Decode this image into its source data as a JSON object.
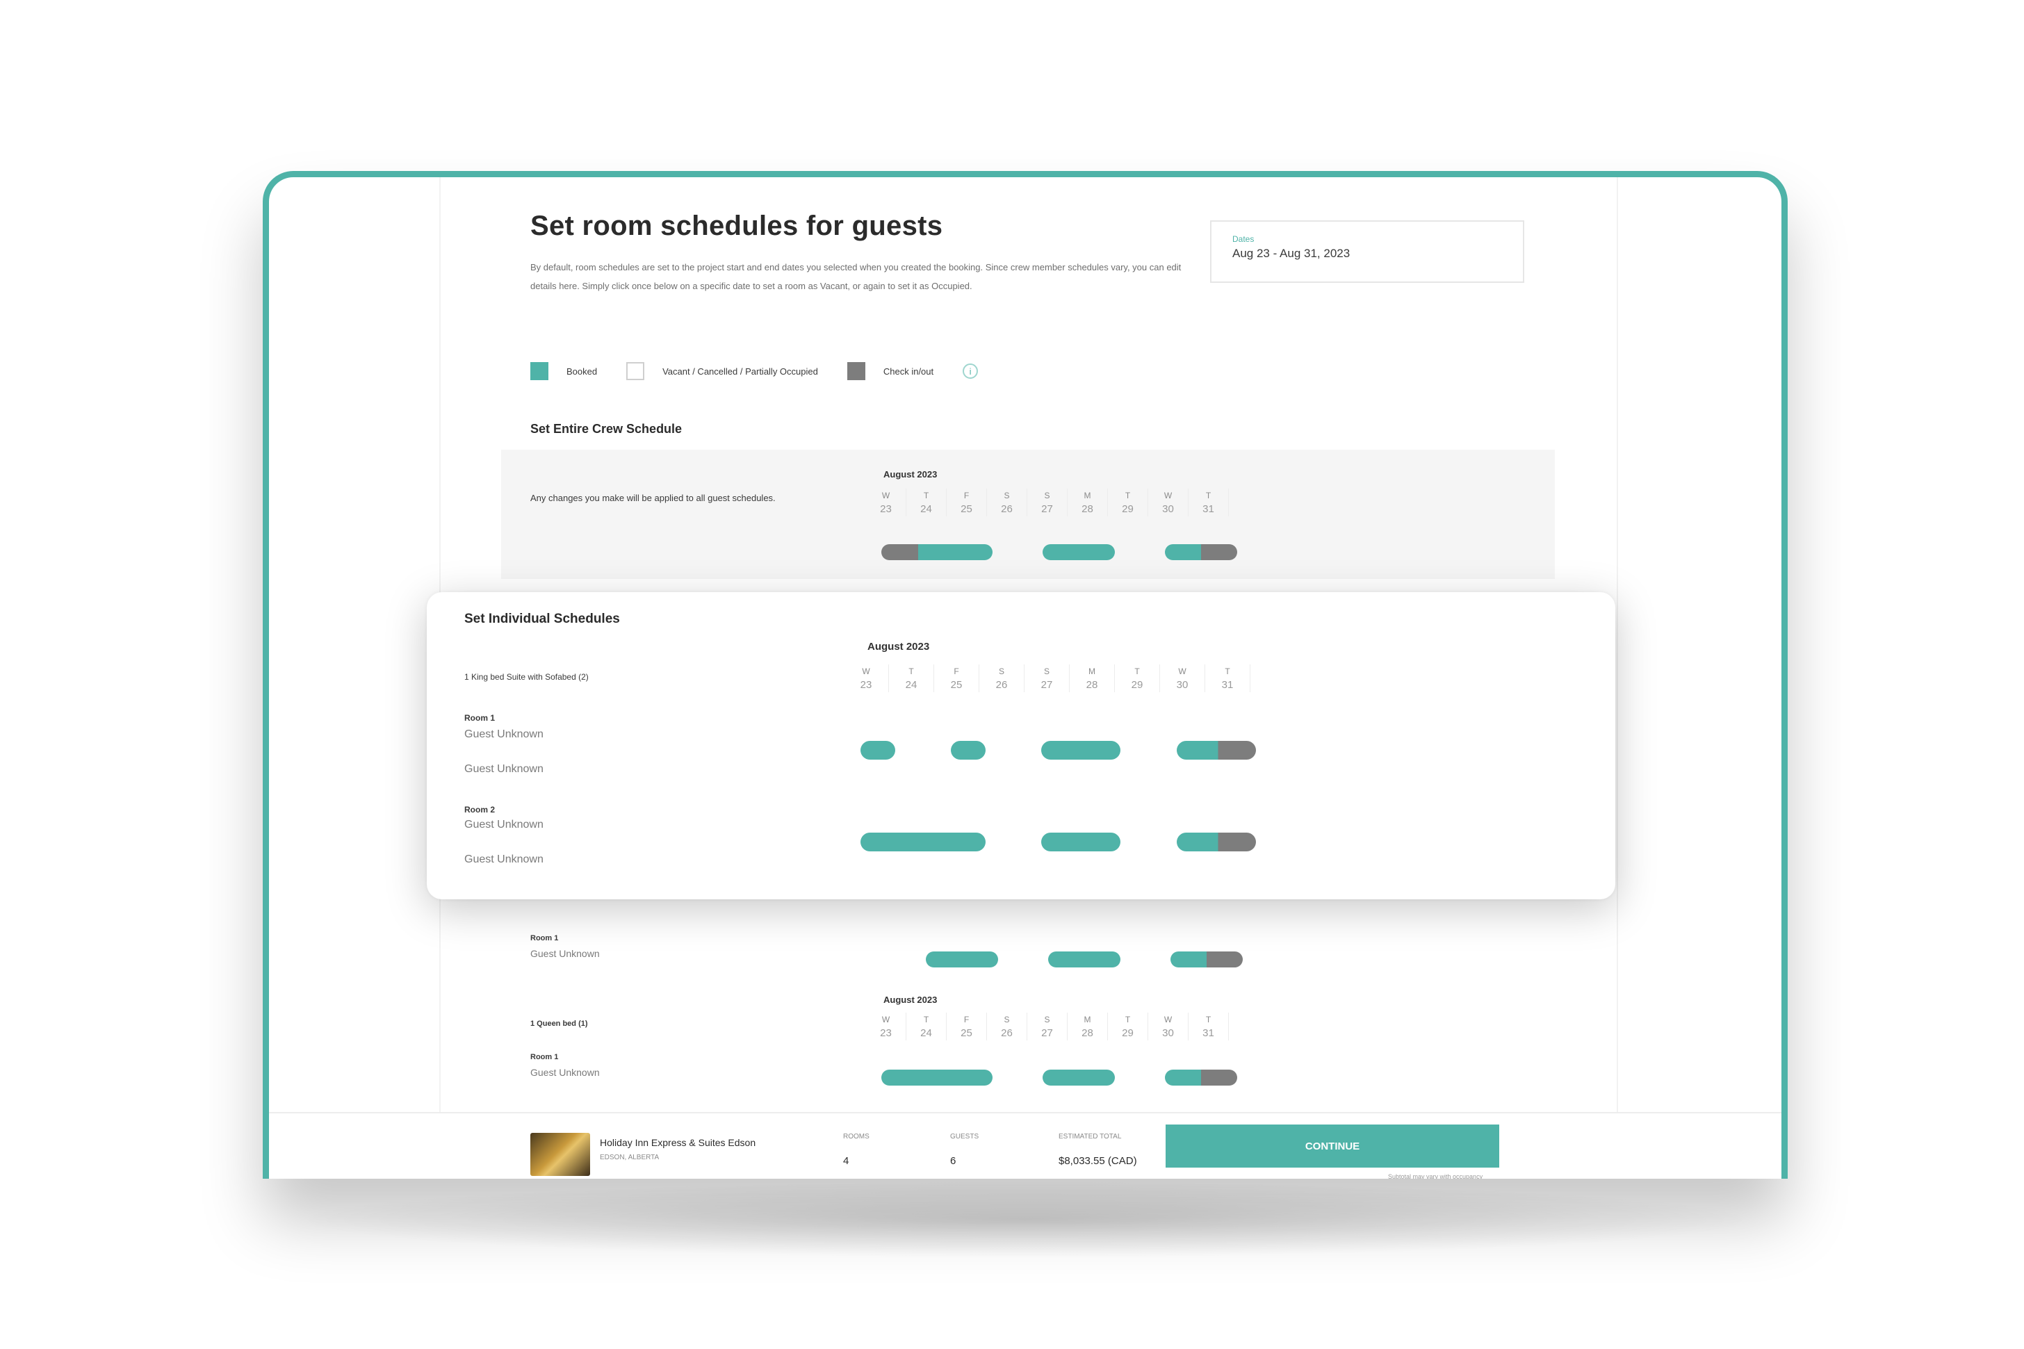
{
  "page": {
    "title": "Set room schedules for guests",
    "description": "By default, room schedules are set to the project start and end dates you selected when you created the booking. Since crew member schedules vary, you can edit details here. Simply click once below on a specific date to set a room as Vacant, or again to set it as Occupied."
  },
  "dates": {
    "label": "Dates",
    "value": "Aug 23 - Aug 31, 2023"
  },
  "legend": [
    {
      "label": "Booked",
      "color": "#4fb3a8"
    },
    {
      "label": "Vacant / Cancelled / Partially Occupied",
      "color": "#ffffff"
    },
    {
      "label": "Check in/out",
      "color": "#7d7d7d"
    }
  ],
  "legend_info_icon": "info-icon",
  "calendar": {
    "month": "August 2023",
    "days": [
      {
        "dow": "W",
        "date": "23"
      },
      {
        "dow": "T",
        "date": "24"
      },
      {
        "dow": "F",
        "date": "25"
      },
      {
        "dow": "S",
        "date": "26"
      },
      {
        "dow": "S",
        "date": "27"
      },
      {
        "dow": "M",
        "date": "28"
      },
      {
        "dow": "T",
        "date": "29"
      },
      {
        "dow": "W",
        "date": "30"
      },
      {
        "dow": "T",
        "date": "31"
      }
    ]
  },
  "crew": {
    "title": "Set Entire Crew Schedule",
    "note": "Any changes you make will be applied to all guest schedules."
  },
  "individual": {
    "title": "Set Individual Schedules",
    "suite": "1 King bed Suite with Sofabed (2)",
    "rooms": [
      {
        "label": "Room 1",
        "guests": [
          "Guest Unknown",
          "Guest Unknown"
        ]
      },
      {
        "label": "Room 2",
        "guests": [
          "Guest Unknown",
          "Guest Unknown"
        ]
      }
    ]
  },
  "lower": {
    "room1_label": "Room 1",
    "room1_guest": "Guest Unknown",
    "queen_label": "1 Queen bed (1)",
    "room2_label": "Room 1",
    "room2_guest": "Guest Unknown"
  },
  "footer": {
    "hotel_name": "Holiday Inn Express & Suites Edson",
    "hotel_location": "EDSON, ALBERTA",
    "rooms_label": "Rooms",
    "rooms_value": "4",
    "guests_label": "Guests",
    "guests_value": "6",
    "total_label": "Estimated Total",
    "total_value": "$8,033.55 (CAD)",
    "continue_label": "CONTINUE",
    "note": "Subtotal may vary with occupancy"
  }
}
